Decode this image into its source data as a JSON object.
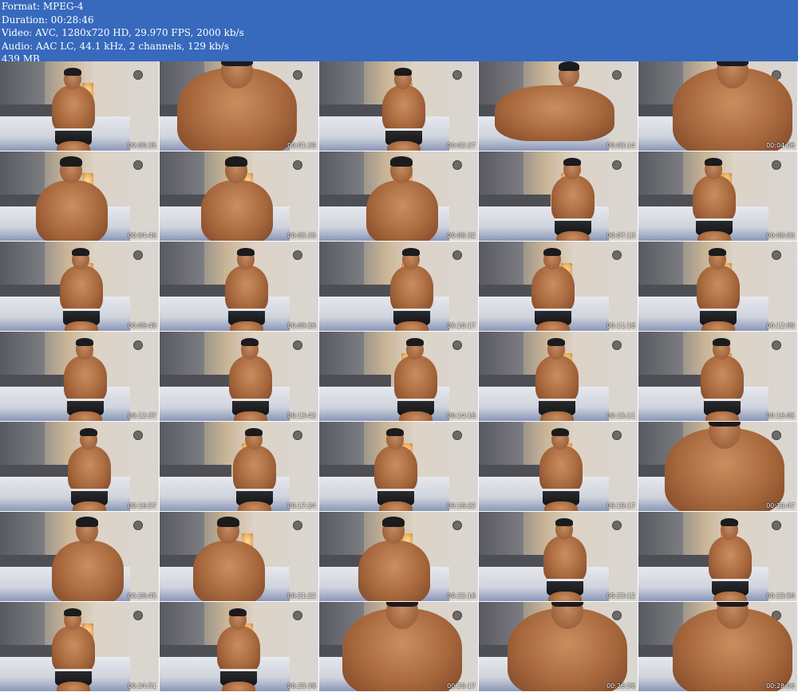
{
  "header": {
    "format": "Format: MPEG-4",
    "duration": "Duration: 00:28:46",
    "video": "Video: AVC, 1280x720 HD, 29.970 FPS, 2000 kb/s",
    "audio": "Audio: AAC LC, 44.1 kHz, 2 channels, 129 kb/s",
    "size": "439 MB"
  },
  "thumbnails": [
    {
      "time": "00:00:35",
      "variant": "bed"
    },
    {
      "time": "00:01:29",
      "variant": "close"
    },
    {
      "time": "00:02:27",
      "variant": "bed"
    },
    {
      "time": "00:03:14",
      "variant": "lying"
    },
    {
      "time": "00:04:06",
      "variant": "close"
    },
    {
      "time": "00:04:46",
      "variant": "sit"
    },
    {
      "time": "00:05:33",
      "variant": "sit"
    },
    {
      "time": "00:06:32",
      "variant": "sit"
    },
    {
      "time": "00:07:13",
      "variant": "stand"
    },
    {
      "time": "00:08:03",
      "variant": "stand"
    },
    {
      "time": "00:08:49",
      "variant": "stand"
    },
    {
      "time": "00:09:26",
      "variant": "stand"
    },
    {
      "time": "00:10:17",
      "variant": "stand"
    },
    {
      "time": "00:11:16",
      "variant": "stand"
    },
    {
      "time": "00:12:09",
      "variant": "stand"
    },
    {
      "time": "00:12:37",
      "variant": "stand"
    },
    {
      "time": "00:13:42",
      "variant": "stand"
    },
    {
      "time": "00:14:16",
      "variant": "stand"
    },
    {
      "time": "00:15:11",
      "variant": "stand"
    },
    {
      "time": "00:16:05",
      "variant": "stand"
    },
    {
      "time": "00:16:57",
      "variant": "stand"
    },
    {
      "time": "00:17:24",
      "variant": "stand"
    },
    {
      "time": "00:18:22",
      "variant": "stand"
    },
    {
      "time": "00:19:17",
      "variant": "stand"
    },
    {
      "time": "00:19:47",
      "variant": "close"
    },
    {
      "time": "00:20:45",
      "variant": "sit"
    },
    {
      "time": "00:21:22",
      "variant": "sit"
    },
    {
      "time": "00:22:16",
      "variant": "sit"
    },
    {
      "time": "00:23:12",
      "variant": "stand"
    },
    {
      "time": "00:23:50",
      "variant": "stand"
    },
    {
      "time": "00:24:51",
      "variant": "stand"
    },
    {
      "time": "00:25:36",
      "variant": "stand"
    },
    {
      "time": "00:26:17",
      "variant": "close"
    },
    {
      "time": "00:26:56",
      "variant": "close"
    },
    {
      "time": "00:28:06",
      "variant": "close"
    }
  ],
  "colors": {
    "header_bg": "#3769bd",
    "header_text": "#ffffff"
  }
}
